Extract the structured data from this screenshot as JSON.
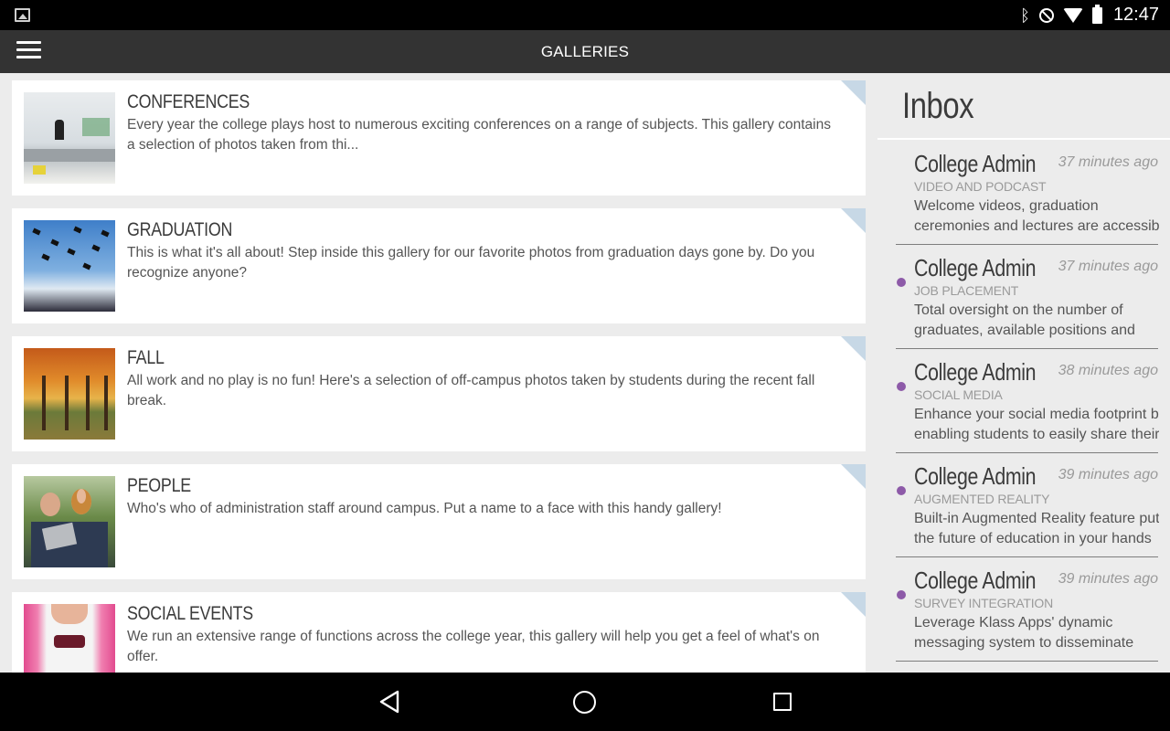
{
  "status_bar": {
    "time": "12:47",
    "icons": [
      "image-notification-icon",
      "bluetooth-icon",
      "do-not-disturb-icon",
      "wifi-icon",
      "battery-icon"
    ]
  },
  "app_bar": {
    "title": "GALLERIES",
    "menu_icon": "hamburger-menu-icon"
  },
  "galleries": [
    {
      "title": "CONFERENCES",
      "description": "Every year the college plays host to numerous exciting conferences on a range of subjects.  This gallery contains a selection of photos taken from thi...",
      "thumbnail": "conference-photo"
    },
    {
      "title": "GRADUATION",
      "description": "This is what it's all about!  Step inside this gallery for our favorite photos from graduation days gone by.  Do you recognize anyone?",
      "thumbnail": "graduation-photo"
    },
    {
      "title": "FALL",
      "description": "All work and no play is no fun!  Here's a selection of off-campus photos taken by students during the recent fall break.",
      "thumbnail": "fall-photo"
    },
    {
      "title": "PEOPLE",
      "description": "Who's who of administration staff around campus.  Put a name to a face with this handy gallery!",
      "thumbnail": "people-photo"
    },
    {
      "title": "SOCIAL EVENTS",
      "description": "We run an extensive range of functions across the college year, this gallery will help you get a feel of what's on offer.",
      "thumbnail": "social-events-photo"
    }
  ],
  "inbox": {
    "heading": "Inbox",
    "messages": [
      {
        "sender": "College Admin",
        "time": "37 minutes ago",
        "category": "VIDEO AND PODCAST",
        "line1": "Welcome videos, graduation",
        "line2": "ceremonies and lectures are accessible",
        "unread": false
      },
      {
        "sender": "College Admin",
        "time": "37 minutes ago",
        "category": "JOB PLACEMENT",
        "line1": "Total oversight on the number of",
        "line2": "graduates, available positions and",
        "unread": true
      },
      {
        "sender": "College Admin",
        "time": "38 minutes ago",
        "category": "SOCIAL MEDIA",
        "line1": "Enhance your social media footprint by",
        "line2": "enabling students to easily share their",
        "unread": true
      },
      {
        "sender": "College Admin",
        "time": "39 minutes ago",
        "category": "AUGMENTED REALITY",
        "line1": "Built-in Augmented Reality feature puts",
        "line2": "the future of education in your hands",
        "unread": true
      },
      {
        "sender": "College Admin",
        "time": "39 minutes ago",
        "category": "SURVEY INTEGRATION",
        "line1": "Leverage Klass Apps' dynamic",
        "line2": "messaging system to disseminate",
        "unread": true
      }
    ]
  },
  "nav_bar": {
    "icons": [
      "back-icon",
      "home-icon",
      "recent-apps-icon"
    ]
  },
  "colors": {
    "app_bar": "#333333",
    "unread_dot": "#8d5aa8",
    "card_corner": "#c7d8e6"
  }
}
